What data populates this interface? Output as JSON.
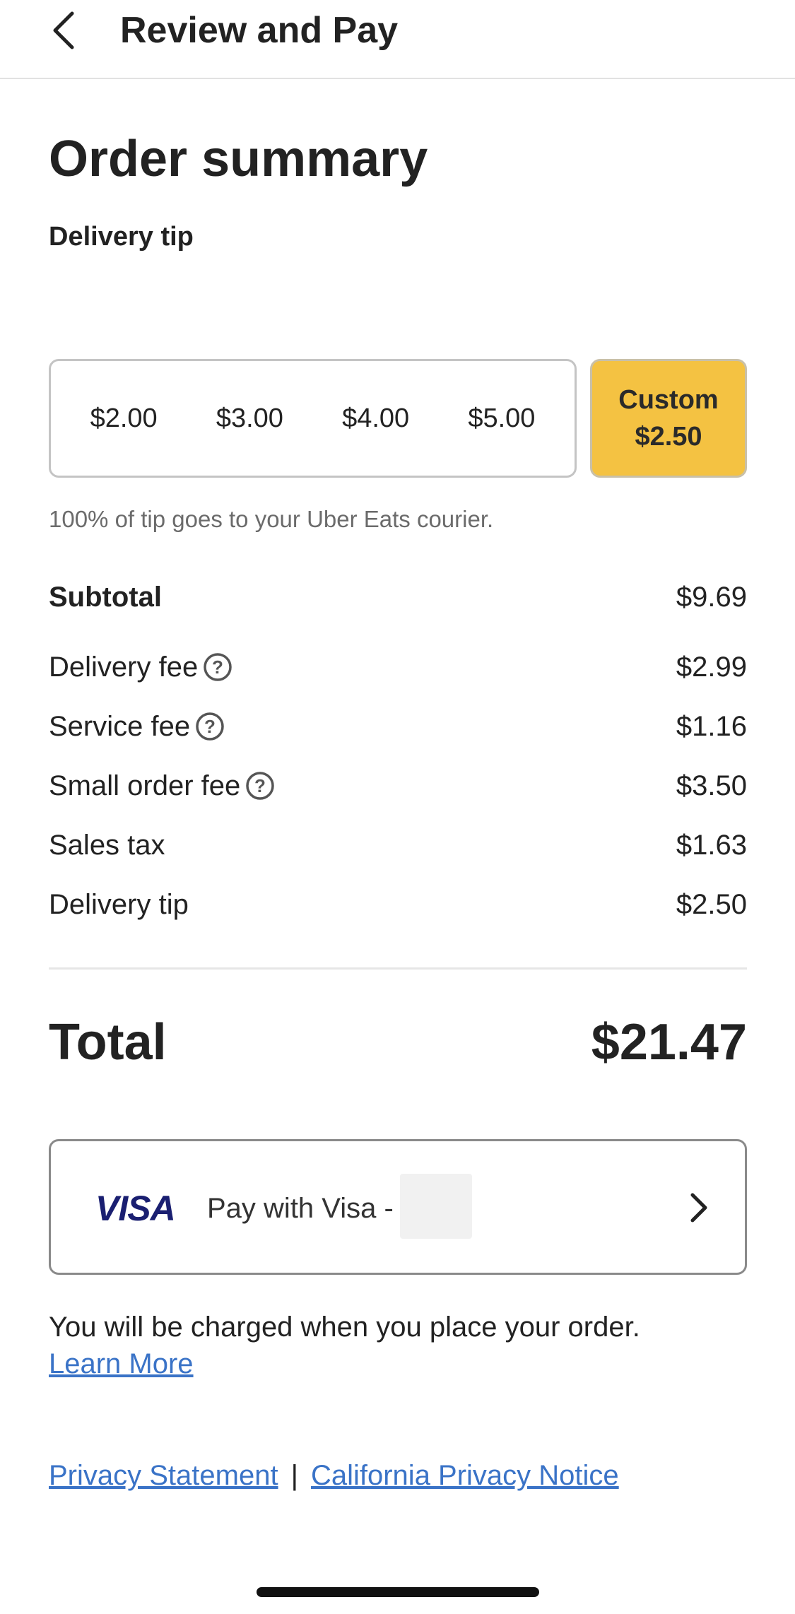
{
  "header": {
    "title": "Review and Pay",
    "back_icon": "chevron-left-icon"
  },
  "page_title": "Order summary",
  "tip_section": {
    "label": "Delivery tip",
    "options": [
      "$2.00",
      "$3.00",
      "$4.00",
      "$5.00"
    ],
    "custom": {
      "label": "Custom",
      "amount": "$2.50",
      "selected": true,
      "color": "#f4c242"
    },
    "note": "100% of tip goes to your Uber Eats courier."
  },
  "fees": {
    "subtotal": {
      "label": "Subtotal",
      "value": "$9.69"
    },
    "delivery_fee": {
      "label": "Delivery fee",
      "value": "$2.99",
      "help_icon": "question-circle-icon"
    },
    "service_fee": {
      "label": "Service fee",
      "value": "$1.16",
      "help_icon": "question-circle-icon"
    },
    "small_order_fee": {
      "label": "Small order fee",
      "value": "$3.50",
      "help_icon": "question-circle-icon"
    },
    "sales_tax": {
      "label": "Sales tax",
      "value": "$1.63"
    },
    "delivery_tip": {
      "label": "Delivery tip",
      "value": "$2.50"
    }
  },
  "total": {
    "label": "Total",
    "value": "$21.47"
  },
  "payment": {
    "logo": "VISA",
    "label": "Pay with Visa -",
    "logo_color": "#1a1f71",
    "chevron_icon": "chevron-right-icon"
  },
  "charge_note": "You will be charged when you place your order.",
  "learn_more": "Learn More",
  "footer": {
    "privacy_statement": "Privacy Statement",
    "separator": "|",
    "california_notice": "California Privacy Notice"
  },
  "colors": {
    "link": "#3a73c7",
    "accent": "#f4c242"
  }
}
